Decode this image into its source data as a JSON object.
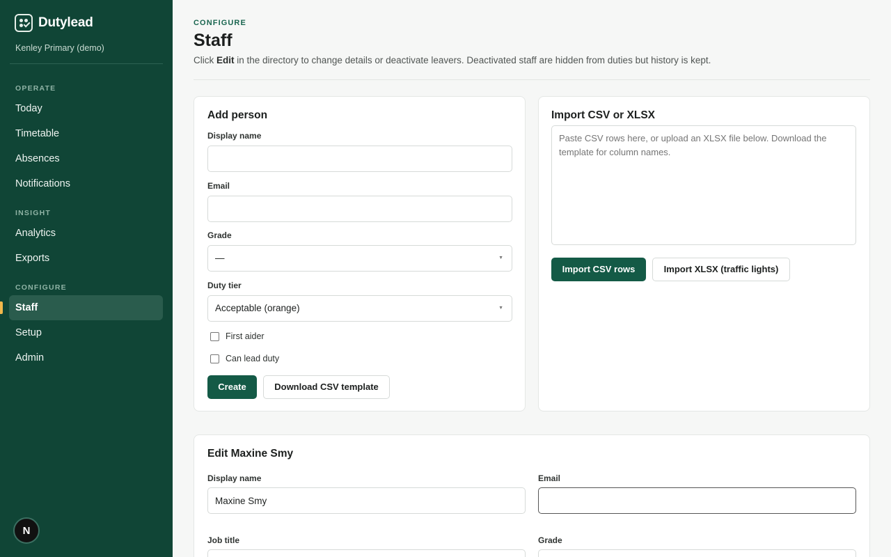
{
  "app": {
    "name": "Dutylead",
    "org": "Kenley Primary (demo)",
    "avatar_initial": "N"
  },
  "sidebar": {
    "sections": [
      {
        "label": "OPERATE",
        "items": [
          "Today",
          "Timetable",
          "Absences",
          "Notifications"
        ]
      },
      {
        "label": "INSIGHT",
        "items": [
          "Analytics",
          "Exports"
        ]
      },
      {
        "label": "CONFIGURE",
        "items": [
          "Staff",
          "Setup",
          "Admin"
        ]
      }
    ],
    "active_item": "Staff"
  },
  "page": {
    "eyebrow": "CONFIGURE",
    "title": "Staff",
    "desc_pre": "Click ",
    "desc_bold": "Edit",
    "desc_post": " in the directory to change details or deactivate leavers. Deactivated staff are hidden from duties but history is kept."
  },
  "add_person": {
    "title": "Add person",
    "display_name_label": "Display name",
    "display_name_value": "",
    "email_label": "Email",
    "email_value": "",
    "grade_label": "Grade",
    "grade_value": "—",
    "duty_tier_label": "Duty tier",
    "duty_tier_value": "Acceptable (orange)",
    "first_aider_label": "First aider",
    "can_lead_label": "Can lead duty",
    "create_label": "Create",
    "download_label": "Download CSV template"
  },
  "import": {
    "title": "Import CSV or XLSX",
    "placeholder": "Paste CSV rows here, or upload an XLSX file below. Download the template for column names.",
    "import_csv_label": "Import CSV rows",
    "import_xlsx_label": "Import XLSX (traffic lights)"
  },
  "edit_person": {
    "title": "Edit Maxine Smy",
    "display_name_label": "Display name",
    "display_name_value": "Maxine Smy",
    "email_label": "Email",
    "email_value": "",
    "job_title_label": "Job title",
    "grade_label": "Grade"
  },
  "colors": {
    "sidebar_bg": "#104536",
    "primary": "#145a46",
    "active_marker": "#f2b84b"
  }
}
